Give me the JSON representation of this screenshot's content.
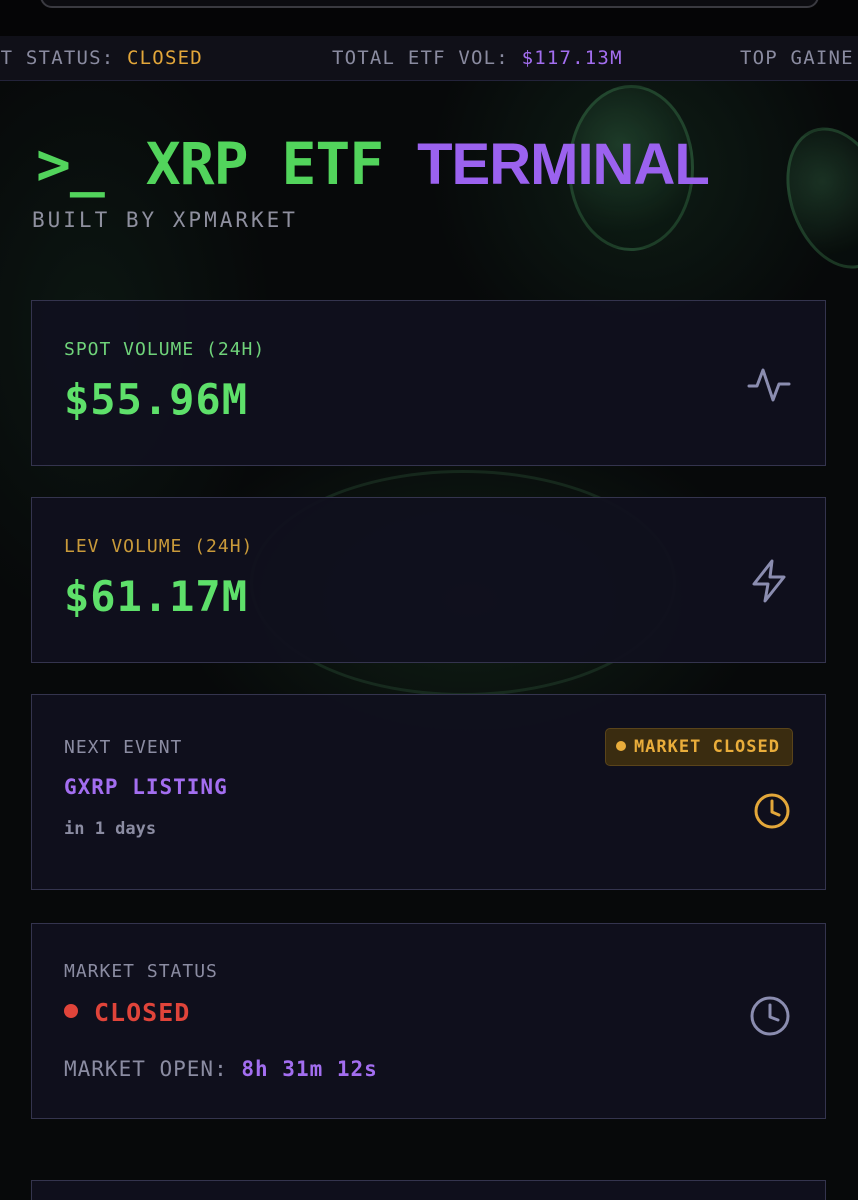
{
  "ticker": {
    "market_status_label": "ET STATUS: ",
    "market_status_value": "CLOSED",
    "total_vol_label": "TOTAL ETF VOL: ",
    "total_vol_value": "$117.13M",
    "top_gainer_label": "TOP GAINE"
  },
  "header": {
    "prompt": ">_",
    "title_part1": "XRP ETF",
    "title_part2": "TERMINAL",
    "subtitle": "BUILT BY XPMARKET"
  },
  "cards": {
    "spot": {
      "label": "SPOT VOLUME (24H)",
      "value": "$55.96M",
      "icon": "activity-pulse-icon"
    },
    "lev": {
      "label": "LEV VOLUME (24H)",
      "value": "$61.17M",
      "icon": "lightning-bolt-icon"
    },
    "event": {
      "label": "NEXT EVENT",
      "name": "GXRP LISTING",
      "time": "in 1 days",
      "badge": "MARKET CLOSED",
      "icon": "clock-icon"
    },
    "status": {
      "label": "MARKET STATUS",
      "value": "CLOSED",
      "open_label": "MARKET OPEN: ",
      "open_time": "8h 31m 12s",
      "icon": "clock-icon"
    }
  },
  "colors": {
    "green": "#52d45c",
    "purple": "#9b62ef",
    "orange": "#e3a73a",
    "red": "#e0443a",
    "card_bg": "#10101e",
    "card_border": "#34344e"
  }
}
